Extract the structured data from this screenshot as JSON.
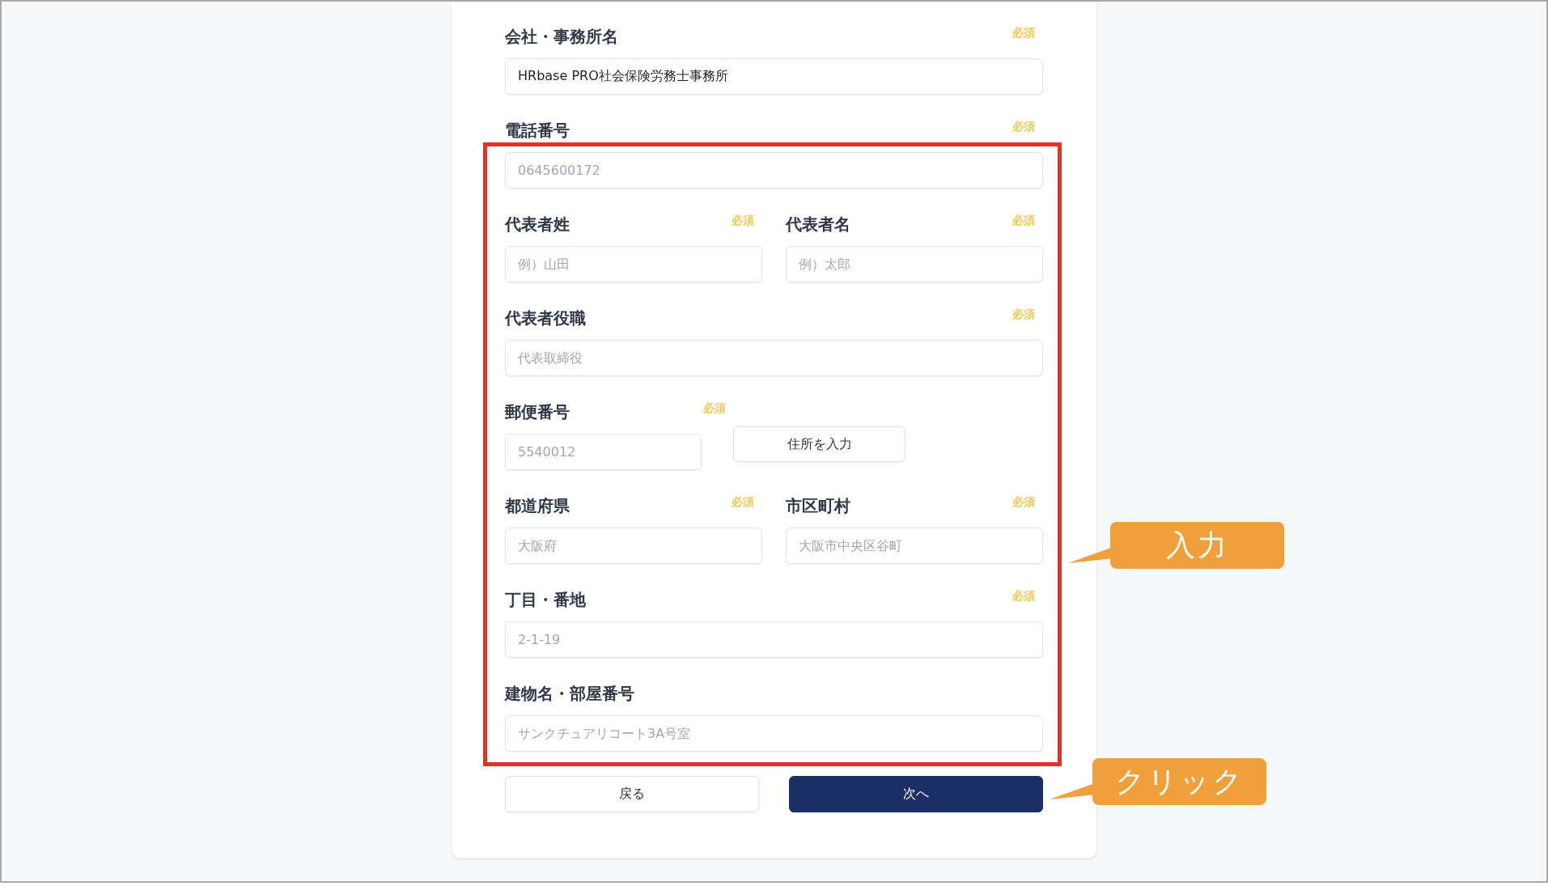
{
  "form": {
    "rows": [
      {
        "kind": "full",
        "fields": [
          {
            "label": "会社・事務所名",
            "badge": "必須",
            "value": "HRbase PRO社会保険労務士事務所"
          }
        ]
      },
      {
        "kind": "full",
        "fields": [
          {
            "label": "電話番号",
            "badge": "必須",
            "placeholder": "0645600172"
          }
        ]
      },
      {
        "kind": "pair",
        "fields": [
          {
            "label": "代表者姓",
            "badge": "必須",
            "placeholder": "例）山田"
          },
          {
            "label": "代表者名",
            "badge": "必須",
            "placeholder": "例）太郎"
          }
        ]
      },
      {
        "kind": "full",
        "fields": [
          {
            "label": "代表者役職",
            "badge": "必須",
            "placeholder": "代表取締役"
          }
        ]
      },
      {
        "kind": "postal",
        "fields": [
          {
            "label": "郵便番号",
            "badge": "必須",
            "placeholder": "5540012"
          }
        ],
        "button": "住所を入力"
      },
      {
        "kind": "pair",
        "fields": [
          {
            "label": "都道府県",
            "badge": "必須",
            "placeholder": "大阪府"
          },
          {
            "label": "市区町村",
            "badge": "必須",
            "placeholder": "大阪市中央区谷町"
          }
        ]
      },
      {
        "kind": "full",
        "fields": [
          {
            "label": "丁目・番地",
            "badge": "必須",
            "placeholder": "2-1-19"
          }
        ]
      },
      {
        "kind": "full",
        "fields": [
          {
            "label": "建物名・部屋番号",
            "placeholder": "サンクチュアリコート3A号室"
          }
        ]
      }
    ],
    "buttons": [
      {
        "label": "戻る",
        "kind": "secondary"
      },
      {
        "label": "次へ",
        "kind": "primary"
      }
    ]
  },
  "callouts": [
    {
      "text": "入力"
    },
    {
      "text": "クリック"
    }
  ]
}
